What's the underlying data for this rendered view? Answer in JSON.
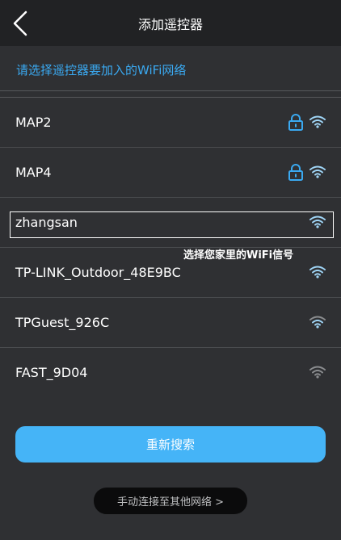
{
  "header": {
    "title": "添加遥控器",
    "back_icon": "chevron-left-icon"
  },
  "prompt": "请选择遥控器要加入的WiFi网络",
  "networks": [
    {
      "ssid": "MAP2",
      "locked": true,
      "signal": "strong"
    },
    {
      "ssid": "MAP4",
      "locked": true,
      "signal": "strong"
    },
    {
      "ssid": "zhangsan",
      "locked": false,
      "signal": "strong",
      "highlighted": true
    },
    {
      "ssid": "TP-LINK_Outdoor_48E9BC",
      "locked": false,
      "signal": "strong"
    },
    {
      "ssid": "TPGuest_926C",
      "locked": false,
      "signal": "medium"
    },
    {
      "ssid": "FAST_9D04",
      "locked": false,
      "signal": "weak"
    }
  ],
  "annotation": "选择您家里的WiFi信号",
  "buttons": {
    "rescan": "重新搜索",
    "manual": "手动连接至其他网络 >"
  },
  "colors": {
    "accent": "#3aa9f1",
    "button": "#45b4f7",
    "wifi_strong": "#9fd4f5",
    "wifi_weak": "#8a8c8f"
  }
}
